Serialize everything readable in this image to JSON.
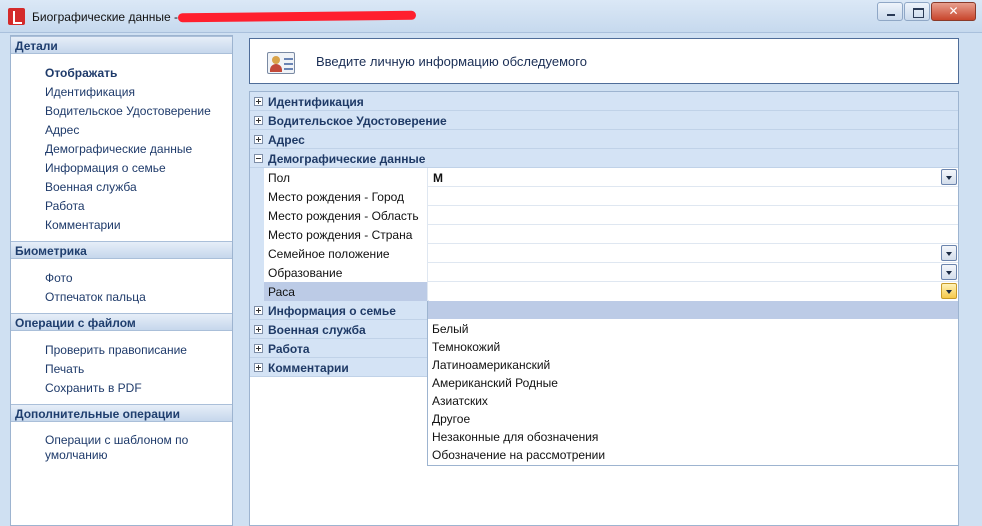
{
  "window": {
    "title": "Биографические данные - ",
    "controls": [
      "minimize",
      "maximize",
      "close"
    ]
  },
  "sidebar": {
    "groups": [
      {
        "header": "Детали",
        "items": [
          "Отображать",
          "Идентификация",
          "Водительское Удостоверение",
          "Адрес",
          "Демографические данные",
          "Информация о семье",
          "Военная служба",
          "Работа",
          "Комментарии"
        ],
        "bold_index": 0
      },
      {
        "header": "Биометрика",
        "items": [
          "Фото",
          "Отпечаток пальца"
        ]
      },
      {
        "header": "Операции с файлом",
        "items": [
          "Проверить правописание",
          "Печать",
          "Сохранить в PDF"
        ]
      },
      {
        "header": "Дополнительные операции",
        "items": [
          "Операции с шаблоном по умолчанию"
        ]
      }
    ]
  },
  "info_box": {
    "title": "Введите личную информацию обследуемого",
    "icon": "person-card-icon"
  },
  "grid": {
    "categories_top": [
      {
        "label": "Идентификация",
        "expanded": false
      },
      {
        "label": "Водительское Удостоверение",
        "expanded": false
      },
      {
        "label": "Адрес",
        "expanded": false
      },
      {
        "label": "Демографические данные",
        "expanded": true
      }
    ],
    "properties": [
      {
        "name": "Пол",
        "value": "М",
        "dropdown": true
      },
      {
        "name": "Место рождения - Город",
        "value": "",
        "dropdown": false
      },
      {
        "name": "Место рождения - Область",
        "value": "",
        "dropdown": false
      },
      {
        "name": "Место рождения - Страна",
        "value": "",
        "dropdown": false
      },
      {
        "name": "Семейное положение",
        "value": "",
        "dropdown": true
      },
      {
        "name": "Образование",
        "value": "",
        "dropdown": true
      },
      {
        "name": "Раса",
        "value": "",
        "dropdown": true,
        "selected": true
      }
    ],
    "categories_bottom": [
      {
        "label": "Информация о семье",
        "expanded": false
      },
      {
        "label": "Военная служба",
        "expanded": false
      },
      {
        "label": "Работа",
        "expanded": false
      },
      {
        "label": "Комментарии",
        "expanded": false
      }
    ]
  },
  "dropdown": {
    "open_for": "Раса",
    "options": [
      "Белый",
      "Темнокожий",
      "Латиноамериканский",
      "Американский Родные",
      "Азиатских",
      "Другое",
      "Незаконные для обозначения",
      "Обозначение на рассмотрении"
    ]
  },
  "colors": {
    "category_bg": "#d4e3f5",
    "selected_bg": "#bccbe6",
    "active_dropdown": "#f6c84a",
    "redaction": "#ff1f2e"
  }
}
